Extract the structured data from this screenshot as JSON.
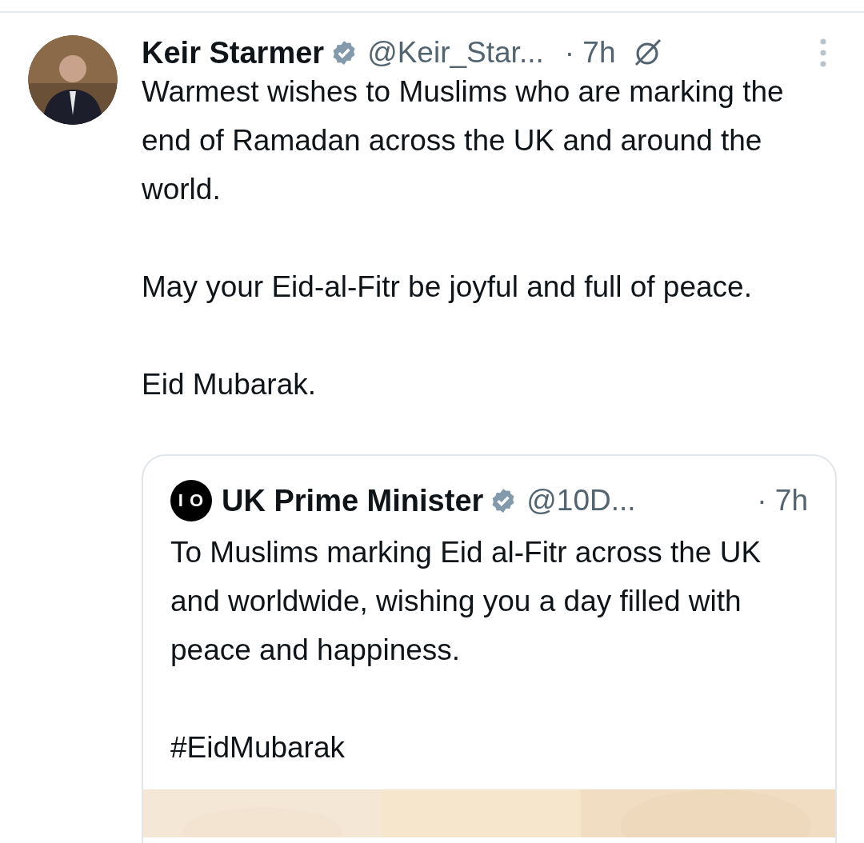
{
  "tweet": {
    "author": {
      "name": "Keir Starmer",
      "verified": true,
      "handle": "@Keir_Star...",
      "time": "· 7h"
    },
    "paragraphs": [
      "Warmest wishes to Muslims who are marking the end of Ramadan across the UK and around the world.",
      "May your Eid-al-Fitr be joyful and full of peace.",
      "Eid Mubarak."
    ],
    "quote": {
      "logo": "I O",
      "name": "UK Prime Minister",
      "verified": true,
      "handle": "@10D...",
      "time": "· 7h",
      "paragraphs": [
        "To Muslims marking Eid al-Fitr across the UK and worldwide, wishing you a day filled with peace and happiness.",
        "#EidMubarak"
      ],
      "media": {
        "kind": "picture"
      }
    }
  }
}
